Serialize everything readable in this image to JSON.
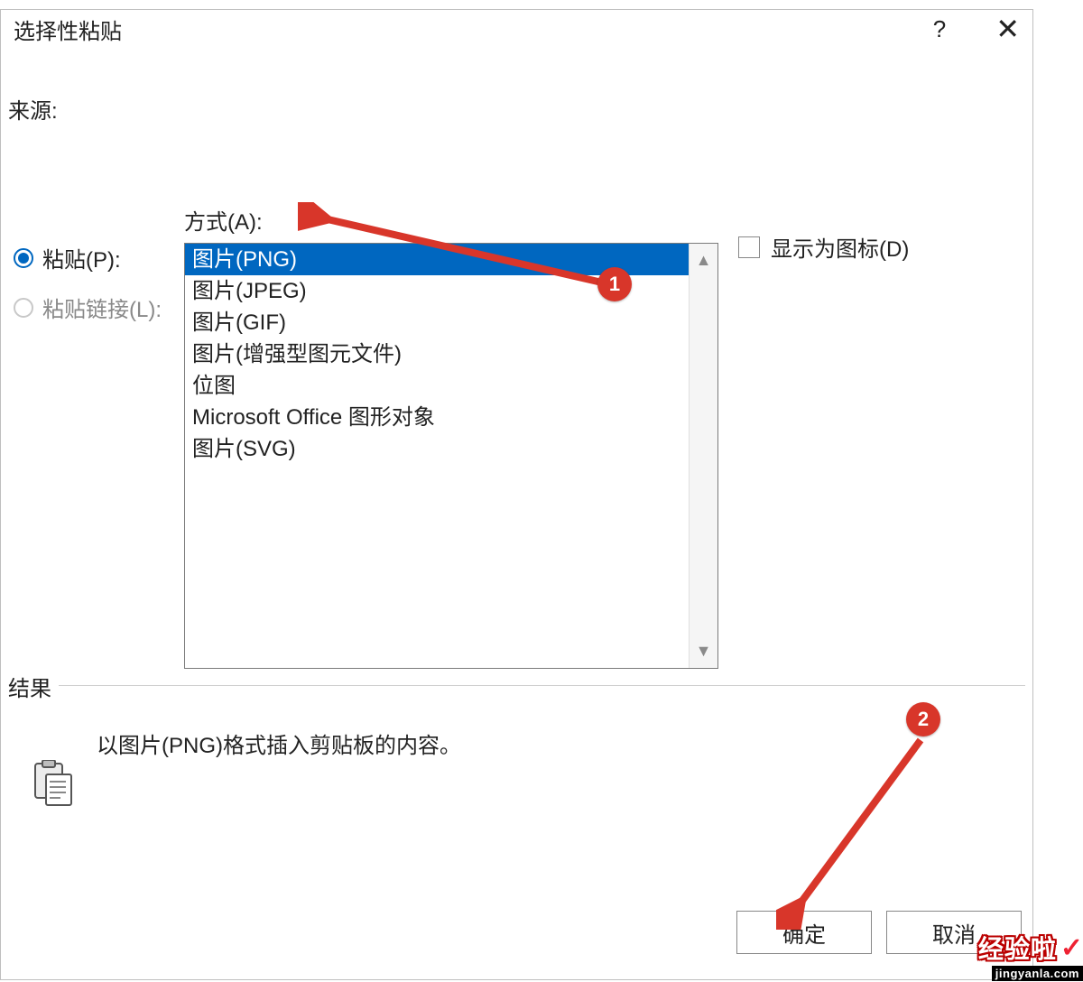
{
  "dialog": {
    "title": "选择性粘贴",
    "help_symbol": "?",
    "close_symbol": "✕",
    "source_label": "来源:",
    "format_label": "方式(A):",
    "radio_paste": "粘贴(P):",
    "radio_paste_link": "粘贴链接(L):",
    "show_as_icon": "显示为图标(D)",
    "list": {
      "items": [
        "图片(PNG)",
        "图片(JPEG)",
        "图片(GIF)",
        "图片(增强型图元文件)",
        "位图",
        "Microsoft Office 图形对象",
        "图片(SVG)"
      ]
    },
    "scroll_up": "▲",
    "scroll_down": "▼",
    "result_title": "结果",
    "result_text": "以图片(PNG)格式插入剪贴板的内容。",
    "ok_label": "确定",
    "cancel_label": "取消"
  },
  "markers": {
    "m1": "1",
    "m2": "2"
  },
  "watermark": {
    "brand": "经验啦",
    "check": "✓",
    "url": "jingyanla.com"
  }
}
